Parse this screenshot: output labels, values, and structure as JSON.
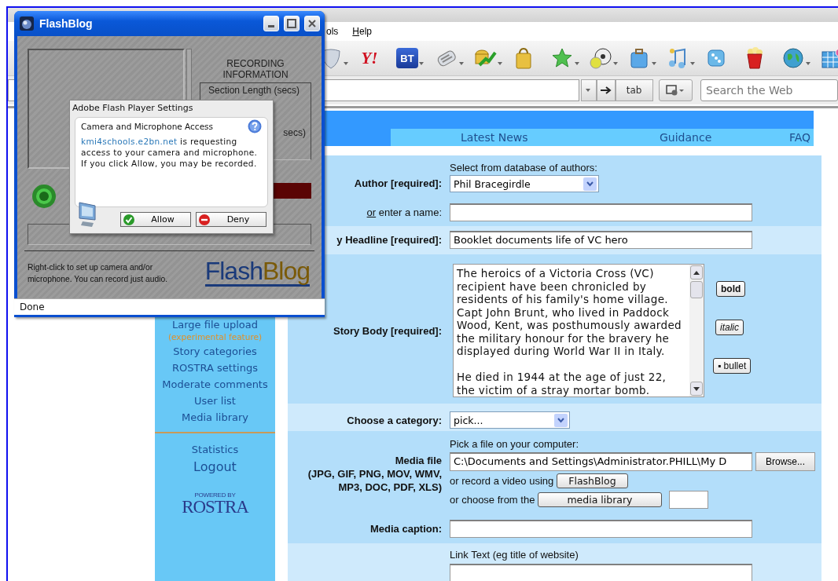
{
  "browser": {
    "menu": [
      {
        "label": "ols"
      },
      {
        "label": "Help"
      }
    ],
    "toolbar": [
      {
        "kind": "shield",
        "menu": true
      },
      {
        "kind": "wordmark",
        "label": "Y!",
        "menu": false
      },
      {
        "kind": "tile",
        "label": "BT",
        "menu": true
      },
      {
        "kind": "newspaper",
        "menu": true
      },
      {
        "kind": "coins",
        "menu": true
      },
      {
        "kind": "bag",
        "menu": false
      },
      {
        "kind": "star",
        "menu": true
      },
      {
        "kind": "balls",
        "menu": true
      },
      {
        "kind": "briefcase",
        "menu": true
      },
      {
        "kind": "music",
        "menu": true
      },
      {
        "kind": "dice",
        "menu": false
      },
      {
        "kind": "popcorn",
        "menu": false
      },
      {
        "kind": "globe",
        "menu": true
      },
      {
        "kind": "calendar",
        "menu": false
      }
    ],
    "tab_button": "tab",
    "search": {
      "placeholder": "Search the Web"
    }
  },
  "site": {
    "nav": [
      "Latest News",
      "Guidance",
      "FAQ"
    ],
    "sidebar": {
      "items": [
        {
          "label": "Large file upload",
          "note": "(experimental feature)"
        },
        {
          "label": "Story categories"
        },
        {
          "label": "ROSTRA settings"
        },
        {
          "label": "Moderate comments"
        },
        {
          "label": "User list"
        },
        {
          "label": "Media library"
        }
      ],
      "footer_items": [
        {
          "label": "Statistics"
        },
        {
          "label": "Logout"
        }
      ],
      "logo": {
        "caption": "POWERED BY",
        "name": "ROSTRA"
      }
    },
    "form": {
      "rows": [
        {
          "kind": "author",
          "label": "Author [required]:",
          "hint": "Select from database of authors:",
          "select": "Phil Bracegirdle",
          "alt_link": "or",
          "alt_label": " enter a name:"
        },
        {
          "kind": "text",
          "label": "y Headline [required]:",
          "value": "Booklet documents life of VC hero"
        },
        {
          "kind": "body",
          "label": "Story Body [required]:",
          "value": "The heroics of a Victoria Cross (VC) recipient have been chronicled by residents of his family's home village. Capt John Brunt, who lived in Paddock Wood, Kent, was posthumously awarded the military honour for the bravery he displayed during World War II in Italy.\n\nHe died in 1944 at the age of just 22, the victim of a stray mortar bomb.",
          "buttons": [
            {
              "label": "bold",
              "kind": "bold"
            },
            {
              "label": "italic",
              "kind": "italic"
            },
            {
              "label": "▪ bullet",
              "kind": "bullet"
            }
          ]
        },
        {
          "kind": "select",
          "label": "Choose a category:",
          "value": "pick..."
        },
        {
          "kind": "media",
          "label": "Media file",
          "sublabel": "(JPG, GIF, PNG, MOV, WMV, MP3, DOC, PDF, XLS)",
          "hint": "Pick a file on your computer:",
          "file": "C:\\Documents and Settings\\Administrator.PHILL\\My D",
          "browse": "Browse...",
          "record_text": "or record a video using",
          "record_button": "FlashBlog",
          "library_text": "or choose from the",
          "library_button": "media library",
          "caption_label": "Media caption:"
        },
        {
          "kind": "link",
          "hint": "Link Text (eg title of website)"
        }
      ]
    }
  },
  "flashblog_window": {
    "title": "FlashBlog",
    "recording_info": "RECORDING INFORMATION",
    "section_length": "Section Length (secs)",
    "secs_label": "secs)",
    "help_text": "Right-click to set up camera and/or microphone. You can record just audio.",
    "logo": {
      "first": "Flash",
      "second": "Blog"
    },
    "status": "Done"
  },
  "flash_settings": {
    "title": "Adobe Flash Player Settings",
    "heading": "Camera and Microphone Access",
    "requester": "kmi4schools.e2bn.net",
    "message": " is requesting access to your camera and microphone. If you click Allow, you may be recorded.",
    "buttons": [
      {
        "label": "Allow",
        "kind": "allow"
      },
      {
        "label": "Deny",
        "kind": "deny"
      }
    ]
  }
}
